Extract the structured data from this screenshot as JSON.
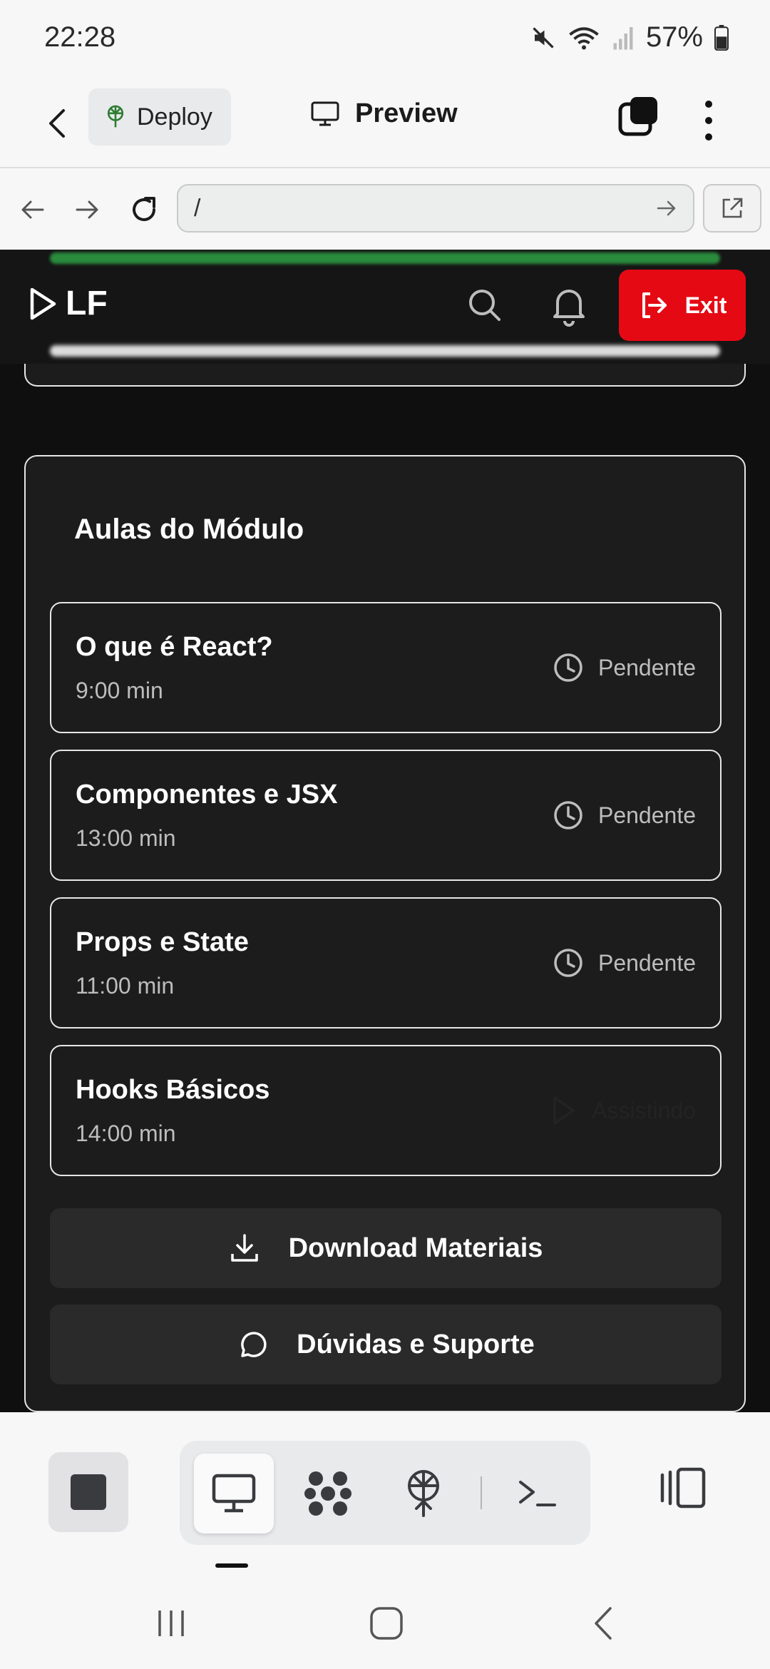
{
  "status_bar": {
    "time": "22:28",
    "battery": "57%",
    "icons": [
      "mute-icon",
      "wifi-icon",
      "signal-icon",
      "battery-icon"
    ]
  },
  "header": {
    "deploy_label": "Deploy",
    "title": "Preview"
  },
  "browser": {
    "url": "/"
  },
  "site": {
    "logo_text": "LF",
    "exit_label": "Exit",
    "accent_color": "#e50914"
  },
  "module": {
    "title": "Aulas do Módulo",
    "lessons": [
      {
        "name": "O que é React?",
        "duration": "9:00 min",
        "status": "Pendente"
      },
      {
        "name": "Componentes e JSX",
        "duration": "13:00 min",
        "status": "Pendente"
      },
      {
        "name": "Props e State",
        "duration": "11:00 min",
        "status": "Pendente"
      },
      {
        "name": "Hooks Básicos",
        "duration": "14:00 min",
        "status": "Assistindo"
      }
    ],
    "download_label": "Download Materiais",
    "support_label": "Dúvidas e Suporte"
  }
}
